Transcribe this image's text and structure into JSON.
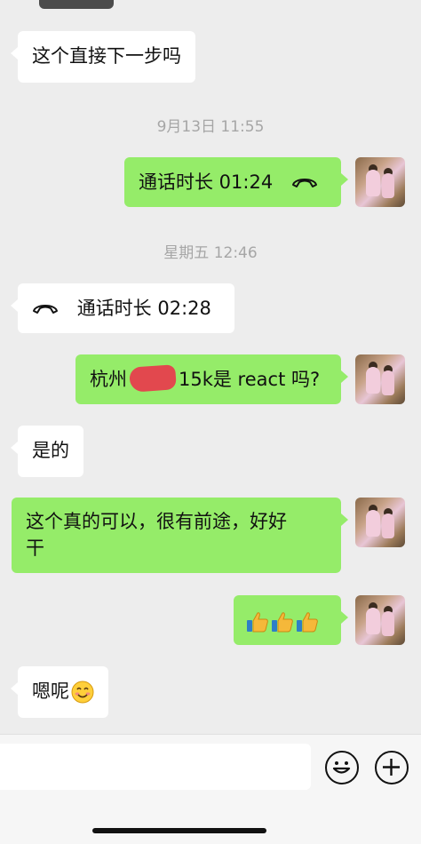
{
  "conversation": {
    "messages": [
      {
        "id": "m1",
        "side": "in",
        "text": "这个直接下一步吗"
      },
      {
        "timestamp": "9月13日 11:55"
      },
      {
        "id": "m2",
        "side": "out",
        "text": "通话时长 01:24",
        "icon": "phone-hangup-icon"
      },
      {
        "timestamp": "星期五 12:46"
      },
      {
        "id": "m3",
        "side": "in",
        "text": "通话时长 02:28",
        "icon": "phone-hangup-icon"
      },
      {
        "id": "m4",
        "side": "out",
        "text_pre": "杭州",
        "text_post": "15k是 react 吗?",
        "redacted": true
      },
      {
        "id": "m5",
        "side": "in",
        "text": "是的"
      },
      {
        "id": "m6",
        "side": "out",
        "line1": "这个真的可以，很有前途，好好",
        "line2": "干"
      },
      {
        "id": "m7",
        "side": "out",
        "emoji": [
          "thumbs-up",
          "thumbs-up",
          "thumbs-up"
        ]
      },
      {
        "id": "m8",
        "side": "in",
        "text": "嗯呢",
        "emoji": "smiling-face"
      }
    ]
  },
  "ts1": "9月13日 11:55",
  "ts2": "星期五 12:46",
  "m1": "这个直接下一步吗",
  "m2": "通话时长 01:24",
  "m3": "通话时长 02:28",
  "m4_pre": "杭州",
  "m4_post": "15k是 react 吗?",
  "m5": "是的",
  "m6_line1": "这个真的可以，很有前途，好好",
  "m6_line2": "干",
  "m8": "嗯呢",
  "colors": {
    "background": "#ededed",
    "incoming": "#ffffff",
    "outgoing": "#95ec69",
    "redaction": "#e83a4c"
  },
  "input": {
    "value": "",
    "placeholder": ""
  }
}
